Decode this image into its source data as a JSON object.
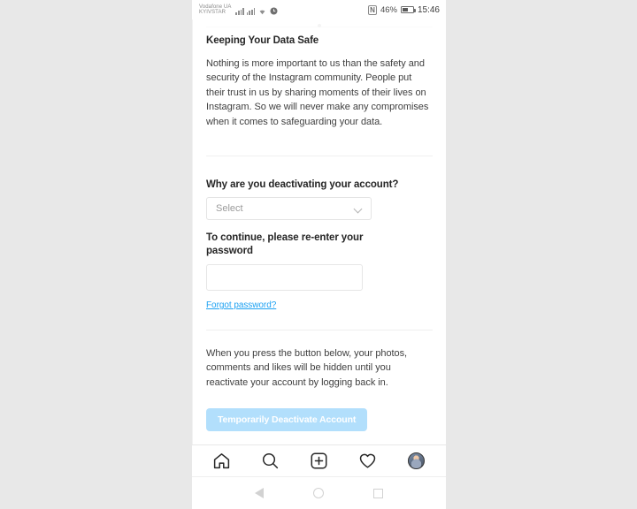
{
  "status_bar": {
    "carrier_primary": "Vodafone UA",
    "carrier_secondary": "KYIVSTAR",
    "signal_icon": "signal-bars-icon",
    "signal_icon_2": "signal-bars-icon-2",
    "wifi_icon": "wifi-icon",
    "alarm_icon": "alarm-icon",
    "nfc_label": "N",
    "battery_percent": "46%",
    "battery_icon": "battery-icon",
    "clock": "15:46"
  },
  "page": {
    "section_title": "Keeping Your Data Safe",
    "intro_paragraph": "Nothing is more important to us than the safety and security of the Instagram community. People put their trust in us by sharing moments of their lives on Instagram. So we will never make any compromises when it comes to safeguarding your data.",
    "reason_label": "Why are you deactivating your account?",
    "reason_select_value": "Select",
    "reason_select_icon": "chevron-down-icon",
    "password_label": "To continue, please re-enter your password",
    "password_value": "",
    "password_placeholder": "",
    "forgot_password_link": "Forgot password?",
    "warning_paragraph": "When you press the button below, your photos, comments and likes will be hidden until you reactivate your account by logging back in.",
    "deactivate_button": "Temporarily Deactivate Account"
  },
  "colors": {
    "link_blue": "#1da1f2",
    "button_blue": "#b2dffc",
    "text_primary": "#262626",
    "text_body": "#404040",
    "divider": "#efefef"
  },
  "tab_bar": {
    "items": [
      {
        "name": "home-icon",
        "label": "Home"
      },
      {
        "name": "search-icon",
        "label": "Search"
      },
      {
        "name": "add-post-icon",
        "label": "New Post"
      },
      {
        "name": "heart-icon",
        "label": "Activity"
      },
      {
        "name": "profile-avatar",
        "label": "Profile"
      }
    ]
  },
  "android_nav": {
    "back": "back-triangle-icon",
    "home": "home-circle-icon",
    "recents": "recents-square-icon"
  }
}
